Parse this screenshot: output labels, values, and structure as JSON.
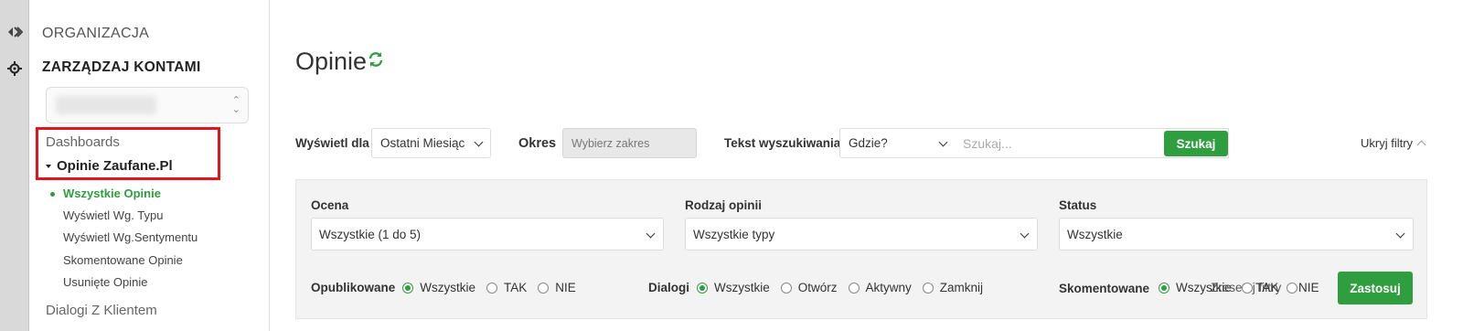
{
  "rail": {
    "icons": [
      "collapse-arrows-icon",
      "crosshair-icon"
    ]
  },
  "sidebar": {
    "org_label": "ORGANIZACJA",
    "manage_label": "ZARZĄDZAJ KONTAMI",
    "dashboards_label": "Dashboards",
    "group_label": "Opinie Zaufane.Pl",
    "items": [
      {
        "label": "Wszystkie Opinie",
        "active": true
      },
      {
        "label": "Wyświetl Wg. Typu",
        "active": false
      },
      {
        "label": "Wyświetl Wg.Sentymentu",
        "active": false
      },
      {
        "label": "Skomentowane Opinie",
        "active": false
      },
      {
        "label": "Usunięte Opinie",
        "active": false
      }
    ],
    "dialogi_label": "Dialogi Z Klientem"
  },
  "header": {
    "title": "Opinie"
  },
  "toolbar": {
    "display_for_label": "Wyświetl dla",
    "display_for_value": "Ostatni Miesiąc",
    "period_label": "Okres",
    "period_placeholder": "Wybierz zakres",
    "search_text_label": "Tekst wyszukiwania",
    "where_value": "Gdzie?",
    "search_placeholder": "Szukaj...",
    "search_button": "Szukaj",
    "hide_filters": "Ukryj filtry"
  },
  "filters": {
    "rating_label": "Ocena",
    "rating_value": "Wszystkie (1 do 5)",
    "type_label": "Rodzaj opinii",
    "type_value": "Wszystkie typy",
    "status_label": "Status",
    "status_value": "Wszystkie",
    "published_label": "Opublikowane",
    "published_options": [
      "Wszystkie",
      "TAK",
      "NIE"
    ],
    "dialogs_label": "Dialogi",
    "dialogs_options": [
      "Wszystkie",
      "Otwórz",
      "Aktywny",
      "Zamknij"
    ],
    "commented_label": "Skomentowane",
    "commented_overlap_text": "Wszystkie",
    "commented_overlap_text2": "Zresetuj filtry",
    "commented_opt_tak": "TAK",
    "commented_opt_nie": "NIE",
    "apply_button": "Zastosuj"
  },
  "colors": {
    "accent_green": "#2e9e3f",
    "highlight_red": "#e3141b"
  }
}
